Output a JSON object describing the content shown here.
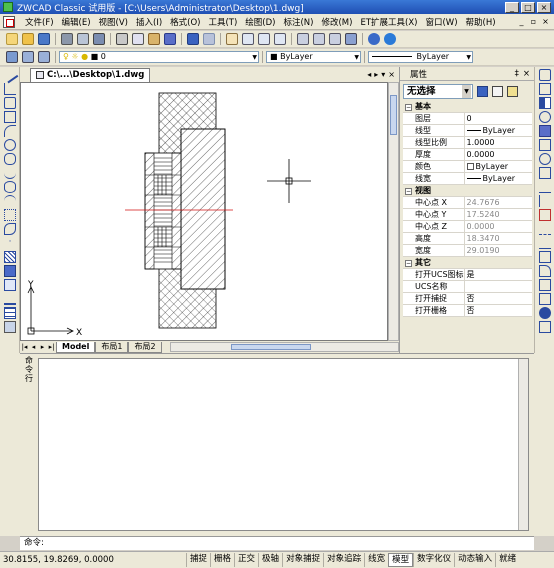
{
  "window": {
    "title": "ZWCAD Classic 试用版 - [C:\\Users\\Administrator\\Desktop\\1.dwg]",
    "buttons": [
      "_",
      "□",
      "×"
    ]
  },
  "menu": {
    "items": [
      "文件(F)",
      "编辑(E)",
      "视图(V)",
      "插入(I)",
      "格式(O)",
      "工具(T)",
      "绘图(D)",
      "标注(N)",
      "修改(M)",
      "ET扩展工具(X)",
      "窗口(W)",
      "帮助(H)"
    ],
    "mdi_buttons": [
      "_",
      "▫",
      "×"
    ]
  },
  "toolbar2": {
    "layer_value": "0",
    "color_value": "ByLayer",
    "linetype_value": "ByLayer"
  },
  "doc_tab": {
    "label": "C:\\...\\Desktop\\1.dwg",
    "controls": [
      "◂",
      "▸",
      "▾",
      "×"
    ]
  },
  "layout_tabs": [
    "Model",
    "布局1",
    "布局2"
  ],
  "canvas": {
    "axis_x": "X",
    "axis_y": "Y"
  },
  "properties": {
    "title": "属性",
    "title_controls": [
      "‡",
      "×"
    ],
    "selection": "无选择",
    "sections": [
      {
        "name": "基本",
        "rows": [
          {
            "k": "图层",
            "v": "0"
          },
          {
            "k": "线型",
            "v": "ByLayer"
          },
          {
            "k": "线型比例",
            "v": "1.0000"
          },
          {
            "k": "厚度",
            "v": "0.0000"
          },
          {
            "k": "颜色",
            "v": "ByLayer"
          },
          {
            "k": "线宽",
            "v": "ByLayer"
          }
        ]
      },
      {
        "name": "视图",
        "rows": [
          {
            "k": "中心点 X",
            "v": "24.7676"
          },
          {
            "k": "中心点 Y",
            "v": "17.5240"
          },
          {
            "k": "中心点 Z",
            "v": "0.0000"
          },
          {
            "k": "高度",
            "v": "18.3470"
          },
          {
            "k": "宽度",
            "v": "29.0190"
          }
        ]
      },
      {
        "name": "其它",
        "rows": [
          {
            "k": "打开UCS图标",
            "v": "是"
          },
          {
            "k": "UCS名称",
            "v": ""
          },
          {
            "k": "打开捕捉",
            "v": "否"
          },
          {
            "k": "打开栅格",
            "v": "否"
          }
        ]
      }
    ]
  },
  "command": {
    "handle_label": "命令行",
    "prompt": "命令:"
  },
  "status": {
    "coords": "30.8155,  19.8269,  0.0000",
    "buttons": [
      "捕捉",
      "栅格",
      "正交",
      "极轴",
      "对象捕捉",
      "对象追踪",
      "线宽",
      "模型",
      "数字化仪",
      "动态输入",
      "就绪"
    ],
    "active": "模型"
  }
}
